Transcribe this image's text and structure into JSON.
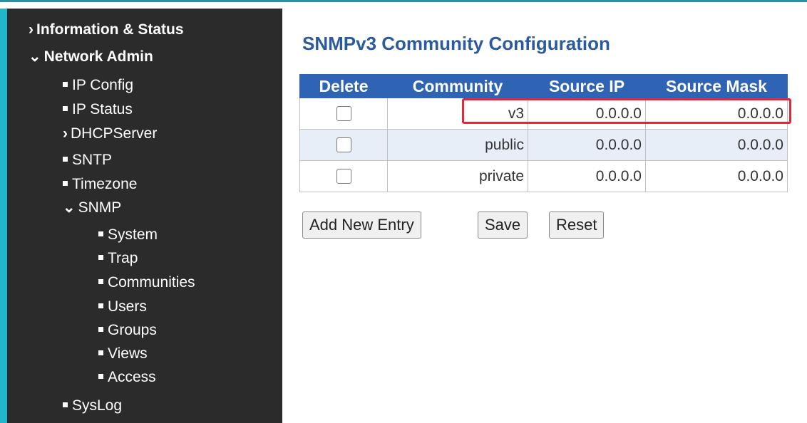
{
  "sidebar": {
    "items": [
      {
        "label": "Information & Status",
        "prefix": "›"
      },
      {
        "label": "Network Admin",
        "prefix": "⌄"
      },
      {
        "label": "IP Config"
      },
      {
        "label": "IP Status"
      },
      {
        "label": "DHCPServer",
        "prefix": "›"
      },
      {
        "label": "SNTP"
      },
      {
        "label": "Timezone"
      },
      {
        "label": "SNMP",
        "prefix": "⌄"
      },
      {
        "label": "System"
      },
      {
        "label": "Trap"
      },
      {
        "label": "Communities"
      },
      {
        "label": "Users"
      },
      {
        "label": "Groups"
      },
      {
        "label": "Views"
      },
      {
        "label": "Access"
      },
      {
        "label": "SysLog"
      }
    ]
  },
  "main": {
    "title": "SNMPv3 Community Configuration",
    "table": {
      "headers": [
        "Delete",
        "Community",
        "Source IP",
        "Source Mask"
      ],
      "rows": [
        {
          "community": "v3",
          "source_ip": "0.0.0.0",
          "source_mask": "0.0.0.0",
          "delete_checked": false
        },
        {
          "community": "public",
          "source_ip": "0.0.0.0",
          "source_mask": "0.0.0.0",
          "delete_checked": false
        },
        {
          "community": "private",
          "source_ip": "0.0.0.0",
          "source_mask": "0.0.0.0",
          "delete_checked": false
        }
      ]
    },
    "buttons": {
      "add": "Add New Entry",
      "save": "Save",
      "reset": "Reset"
    }
  },
  "colors": {
    "sidebar_bg": "#2b2b2b",
    "accent": "#22b6c9",
    "header_bg": "#2f64b4",
    "title": "#2b5b9e",
    "highlight": "#e0283a"
  }
}
